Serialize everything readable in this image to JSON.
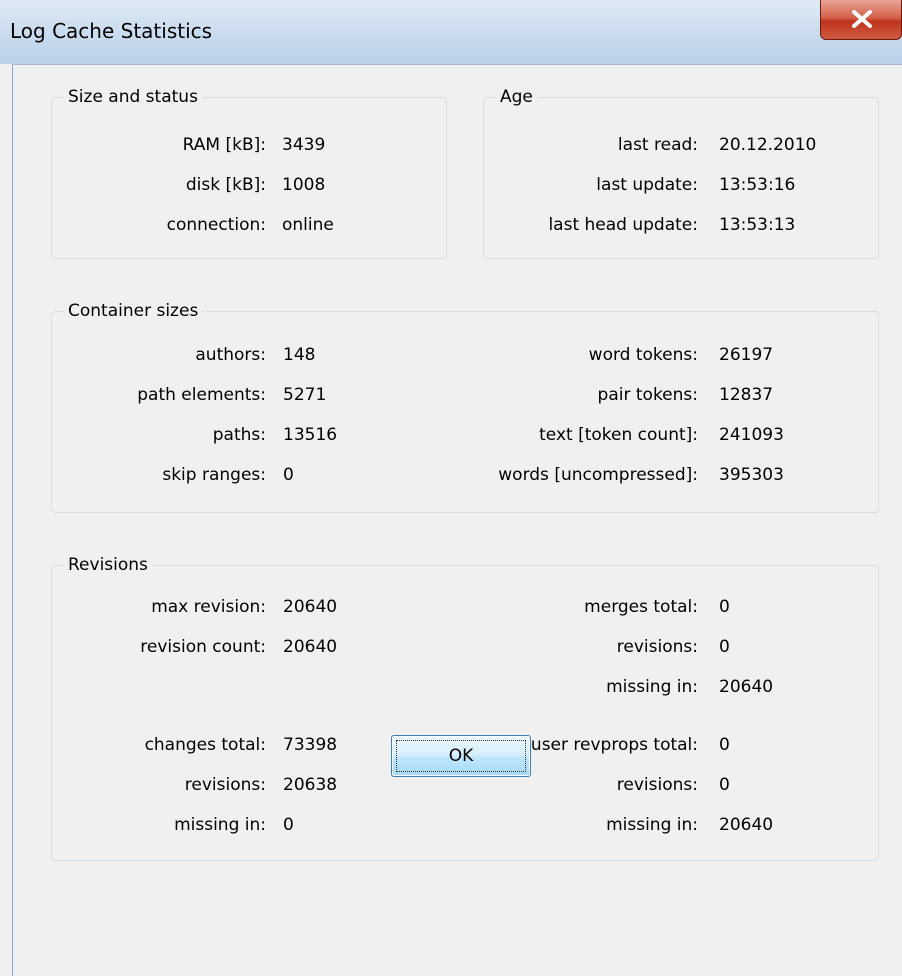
{
  "window": {
    "title": "Log Cache Statistics",
    "close_symbol": "X"
  },
  "size_status": {
    "title": "Size and status",
    "rows": [
      {
        "label": "RAM [kB]:",
        "value": "3439"
      },
      {
        "label": "disk [kB]:",
        "value": "1008"
      },
      {
        "label": "connection:",
        "value": "online"
      }
    ]
  },
  "age": {
    "title": "Age",
    "rows": [
      {
        "label": "last read:",
        "value": "20.12.2010"
      },
      {
        "label": "last update:",
        "value": "13:53:16"
      },
      {
        "label": "last head update:",
        "value": "13:53:13"
      }
    ]
  },
  "container_sizes": {
    "title": "Container sizes",
    "left": [
      {
        "label": "authors:",
        "value": "148"
      },
      {
        "label": "path elements:",
        "value": "5271"
      },
      {
        "label": "paths:",
        "value": "13516"
      },
      {
        "label": "skip ranges:",
        "value": "0"
      }
    ],
    "right": [
      {
        "label": "word tokens:",
        "value": "26197"
      },
      {
        "label": "pair tokens:",
        "value": "12837"
      },
      {
        "label": "text [token count]:",
        "value": "241093"
      },
      {
        "label": "words [uncompressed]:",
        "value": "395303"
      }
    ]
  },
  "revisions": {
    "title": "Revisions",
    "left": [
      {
        "label": "max revision:",
        "value": "20640"
      },
      {
        "label": "revision count:",
        "value": "20640"
      },
      {
        "label": "changes total:",
        "value": "73398"
      },
      {
        "label": "revisions:",
        "value": "20638"
      },
      {
        "label": "missing in:",
        "value": "0"
      }
    ],
    "right": [
      {
        "label": "merges total:",
        "value": "0"
      },
      {
        "label": "revisions:",
        "value": "0"
      },
      {
        "label": "missing in:",
        "value": "20640"
      },
      {
        "label": "user revprops total:",
        "value": "0"
      },
      {
        "label": "revisions:",
        "value": "0"
      },
      {
        "label": "missing in:",
        "value": "20640"
      }
    ]
  },
  "buttons": {
    "ok": "OK"
  }
}
